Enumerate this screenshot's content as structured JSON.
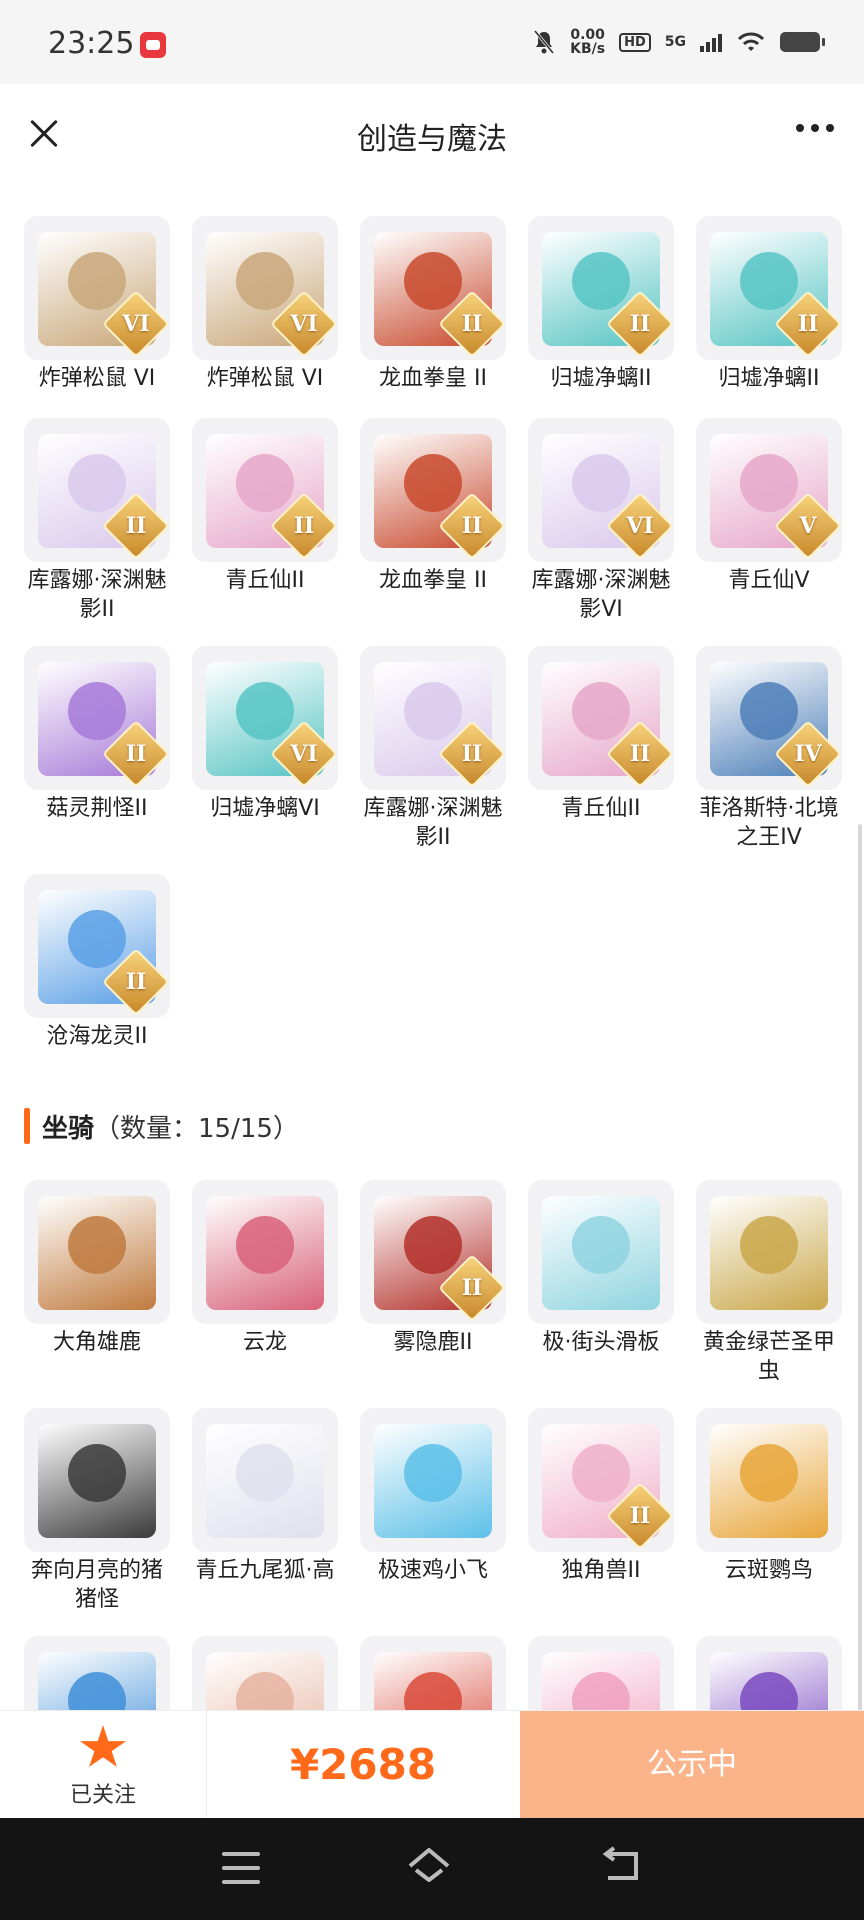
{
  "status_bar": {
    "time": "23:25",
    "speed_value": "0.00",
    "speed_unit": "KB/s",
    "hd_label": "HD",
    "network_label": "5G"
  },
  "header": {
    "title": "创造与魔法",
    "close_icon": "close-icon",
    "more_icon": "more-icon"
  },
  "pets": [
    {
      "name": "炸弹松鼠 VI",
      "badge": "VI",
      "color": "#c9a77a"
    },
    {
      "name": "炸弹松鼠 VI",
      "badge": "VI",
      "color": "#c9a77a"
    },
    {
      "name": "龙血拳皇 II",
      "badge": "II",
      "color": "#c84a2e"
    },
    {
      "name": "归墟净螭II",
      "badge": "II",
      "color": "#57c4c4"
    },
    {
      "name": "归墟净螭II",
      "badge": "II",
      "color": "#57c4c4"
    },
    {
      "name": "库露娜·深渊魅影II",
      "badge": "II",
      "color": "#d9c9ec"
    },
    {
      "name": "青丘仙II",
      "badge": "II",
      "color": "#e6a7c9"
    },
    {
      "name": "龙血拳皇 II",
      "badge": "II",
      "color": "#c84a2e"
    },
    {
      "name": "库露娜·深渊魅影VI",
      "badge": "VI",
      "color": "#d9c9ec"
    },
    {
      "name": "青丘仙V",
      "badge": "V",
      "color": "#e6a7c9"
    },
    {
      "name": "菇灵荆怪II",
      "badge": "II",
      "color": "#a77ad8"
    },
    {
      "name": "归墟净螭VI",
      "badge": "VI",
      "color": "#57c4c4"
    },
    {
      "name": "库露娜·深渊魅影II",
      "badge": "II",
      "color": "#d9c9ec"
    },
    {
      "name": "青丘仙II",
      "badge": "II",
      "color": "#e6a7c9"
    },
    {
      "name": "菲洛斯特·北境之王IV",
      "badge": "IV",
      "color": "#4d7fb8"
    },
    {
      "name": "沧海龙灵II",
      "badge": "II",
      "color": "#5ba0e6"
    }
  ],
  "mounts_section": {
    "title": "坐骑",
    "count_text": "（数量：15/15）"
  },
  "mounts": [
    {
      "name": "大角雄鹿",
      "badge": "",
      "color": "#c07a3e"
    },
    {
      "name": "云龙",
      "badge": "",
      "color": "#d8627a"
    },
    {
      "name": "雾隐鹿II",
      "badge": "II",
      "color": "#b3302a"
    },
    {
      "name": "极·街头滑板",
      "badge": "",
      "color": "#8fd4e0"
    },
    {
      "name": "黄金绿芒圣甲虫",
      "badge": "",
      "color": "#c9a74a"
    },
    {
      "name": "奔向月亮的猪猪怪",
      "badge": "",
      "color": "#3a3a3a"
    },
    {
      "name": "青丘九尾狐·高",
      "badge": "",
      "color": "#e0e0ee"
    },
    {
      "name": "极速鸡小飞",
      "badge": "",
      "color": "#5cc0e8"
    },
    {
      "name": "独角兽II",
      "badge": "II",
      "color": "#f0b0c8"
    },
    {
      "name": "云斑鹦鸟",
      "badge": "",
      "color": "#e8a63a"
    },
    {
      "name": "",
      "badge": "",
      "color": "#3f8fd8"
    },
    {
      "name": "",
      "badge": "",
      "color": "#e6b3a0"
    },
    {
      "name": "",
      "badge": "",
      "color": "#d84a3a"
    },
    {
      "name": "",
      "badge": "",
      "color": "#f0a0c0"
    },
    {
      "name": "",
      "badge": "",
      "color": "#7a4ac0"
    }
  ],
  "bottom_bar": {
    "follow_label": "已关注",
    "price": "¥2688",
    "status_label": "公示中",
    "accent": "#ff6a1a"
  },
  "nav_bar": {
    "menu_icon": "menu-icon",
    "home_icon": "home-icon",
    "back_icon": "back-icon"
  }
}
